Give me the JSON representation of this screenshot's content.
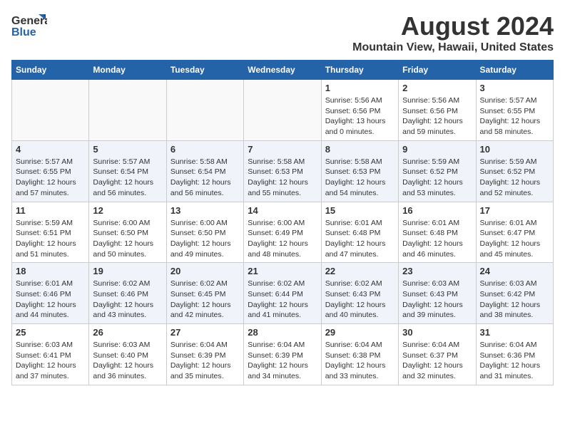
{
  "header": {
    "logo_line1": "General",
    "logo_line2": "Blue",
    "month_year": "August 2024",
    "location": "Mountain View, Hawaii, United States"
  },
  "weekdays": [
    "Sunday",
    "Monday",
    "Tuesday",
    "Wednesday",
    "Thursday",
    "Friday",
    "Saturday"
  ],
  "weeks": [
    [
      {
        "day": "",
        "info": ""
      },
      {
        "day": "",
        "info": ""
      },
      {
        "day": "",
        "info": ""
      },
      {
        "day": "",
        "info": ""
      },
      {
        "day": "1",
        "info": "Sunrise: 5:56 AM\nSunset: 6:56 PM\nDaylight: 13 hours\nand 0 minutes."
      },
      {
        "day": "2",
        "info": "Sunrise: 5:56 AM\nSunset: 6:56 PM\nDaylight: 12 hours\nand 59 minutes."
      },
      {
        "day": "3",
        "info": "Sunrise: 5:57 AM\nSunset: 6:55 PM\nDaylight: 12 hours\nand 58 minutes."
      }
    ],
    [
      {
        "day": "4",
        "info": "Sunrise: 5:57 AM\nSunset: 6:55 PM\nDaylight: 12 hours\nand 57 minutes."
      },
      {
        "day": "5",
        "info": "Sunrise: 5:57 AM\nSunset: 6:54 PM\nDaylight: 12 hours\nand 56 minutes."
      },
      {
        "day": "6",
        "info": "Sunrise: 5:58 AM\nSunset: 6:54 PM\nDaylight: 12 hours\nand 56 minutes."
      },
      {
        "day": "7",
        "info": "Sunrise: 5:58 AM\nSunset: 6:53 PM\nDaylight: 12 hours\nand 55 minutes."
      },
      {
        "day": "8",
        "info": "Sunrise: 5:58 AM\nSunset: 6:53 PM\nDaylight: 12 hours\nand 54 minutes."
      },
      {
        "day": "9",
        "info": "Sunrise: 5:59 AM\nSunset: 6:52 PM\nDaylight: 12 hours\nand 53 minutes."
      },
      {
        "day": "10",
        "info": "Sunrise: 5:59 AM\nSunset: 6:52 PM\nDaylight: 12 hours\nand 52 minutes."
      }
    ],
    [
      {
        "day": "11",
        "info": "Sunrise: 5:59 AM\nSunset: 6:51 PM\nDaylight: 12 hours\nand 51 minutes."
      },
      {
        "day": "12",
        "info": "Sunrise: 6:00 AM\nSunset: 6:50 PM\nDaylight: 12 hours\nand 50 minutes."
      },
      {
        "day": "13",
        "info": "Sunrise: 6:00 AM\nSunset: 6:50 PM\nDaylight: 12 hours\nand 49 minutes."
      },
      {
        "day": "14",
        "info": "Sunrise: 6:00 AM\nSunset: 6:49 PM\nDaylight: 12 hours\nand 48 minutes."
      },
      {
        "day": "15",
        "info": "Sunrise: 6:01 AM\nSunset: 6:48 PM\nDaylight: 12 hours\nand 47 minutes."
      },
      {
        "day": "16",
        "info": "Sunrise: 6:01 AM\nSunset: 6:48 PM\nDaylight: 12 hours\nand 46 minutes."
      },
      {
        "day": "17",
        "info": "Sunrise: 6:01 AM\nSunset: 6:47 PM\nDaylight: 12 hours\nand 45 minutes."
      }
    ],
    [
      {
        "day": "18",
        "info": "Sunrise: 6:01 AM\nSunset: 6:46 PM\nDaylight: 12 hours\nand 44 minutes."
      },
      {
        "day": "19",
        "info": "Sunrise: 6:02 AM\nSunset: 6:46 PM\nDaylight: 12 hours\nand 43 minutes."
      },
      {
        "day": "20",
        "info": "Sunrise: 6:02 AM\nSunset: 6:45 PM\nDaylight: 12 hours\nand 42 minutes."
      },
      {
        "day": "21",
        "info": "Sunrise: 6:02 AM\nSunset: 6:44 PM\nDaylight: 12 hours\nand 41 minutes."
      },
      {
        "day": "22",
        "info": "Sunrise: 6:02 AM\nSunset: 6:43 PM\nDaylight: 12 hours\nand 40 minutes."
      },
      {
        "day": "23",
        "info": "Sunrise: 6:03 AM\nSunset: 6:43 PM\nDaylight: 12 hours\nand 39 minutes."
      },
      {
        "day": "24",
        "info": "Sunrise: 6:03 AM\nSunset: 6:42 PM\nDaylight: 12 hours\nand 38 minutes."
      }
    ],
    [
      {
        "day": "25",
        "info": "Sunrise: 6:03 AM\nSunset: 6:41 PM\nDaylight: 12 hours\nand 37 minutes."
      },
      {
        "day": "26",
        "info": "Sunrise: 6:03 AM\nSunset: 6:40 PM\nDaylight: 12 hours\nand 36 minutes."
      },
      {
        "day": "27",
        "info": "Sunrise: 6:04 AM\nSunset: 6:39 PM\nDaylight: 12 hours\nand 35 minutes."
      },
      {
        "day": "28",
        "info": "Sunrise: 6:04 AM\nSunset: 6:39 PM\nDaylight: 12 hours\nand 34 minutes."
      },
      {
        "day": "29",
        "info": "Sunrise: 6:04 AM\nSunset: 6:38 PM\nDaylight: 12 hours\nand 33 minutes."
      },
      {
        "day": "30",
        "info": "Sunrise: 6:04 AM\nSunset: 6:37 PM\nDaylight: 12 hours\nand 32 minutes."
      },
      {
        "day": "31",
        "info": "Sunrise: 6:04 AM\nSunset: 6:36 PM\nDaylight: 12 hours\nand 31 minutes."
      }
    ]
  ]
}
